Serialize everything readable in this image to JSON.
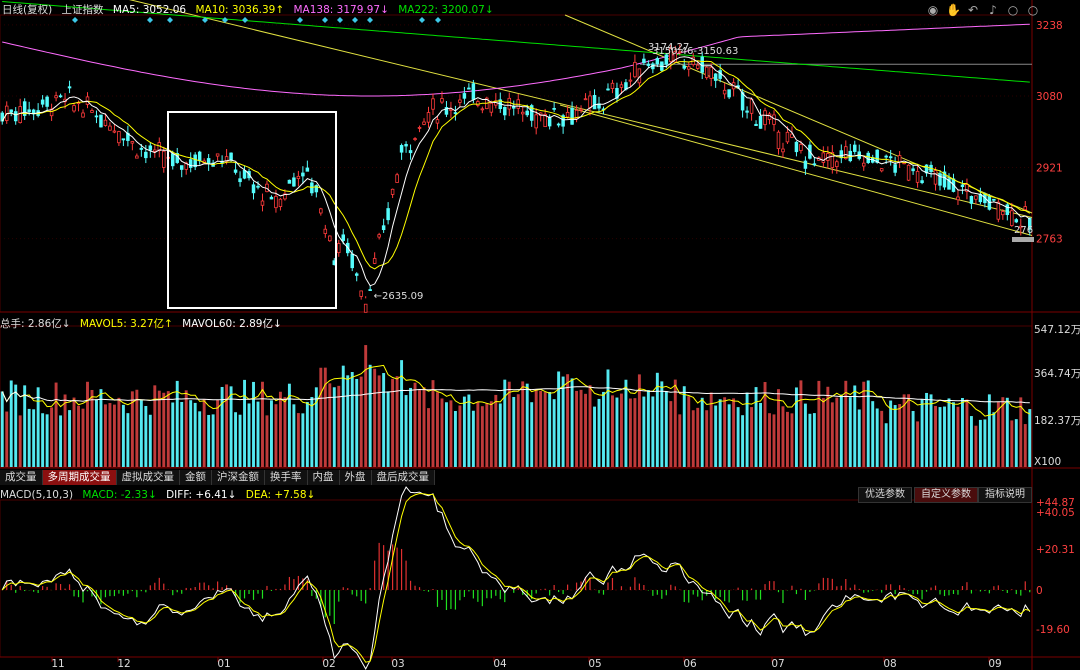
{
  "header": {
    "title": "日线(复权)",
    "symbol": "上证指数",
    "ma5": "MA5: 3052.06",
    "ma10": "MA10: 3036.39↑",
    "ma138": "MA138: 3179.97↓",
    "ma222": "MA222: 3200.07↓"
  },
  "volume_header": {
    "total": "总手: 2.86亿↓",
    "mavol5": "MAVOL5: 3.27亿↑",
    "mavol60": "MAVOL60: 2.89亿↓"
  },
  "macd_header": {
    "name": "MACD(5,10,3)",
    "macd": "MACD: -2.33↓",
    "diff": "DIFF: +6.41↓",
    "dea": "DEA: +7.58↓"
  },
  "tabs": [
    "成交量",
    "多周期成交量",
    "虚拟成交量",
    "金额",
    "沪深金额",
    "换手率",
    "内盘",
    "外盘",
    "盘后成交量"
  ],
  "active_tab": 1,
  "buttons": {
    "preferred": "优选参数",
    "custom": "自定义参数",
    "help": "指标说明"
  },
  "icons": [
    "eye-icon",
    "hand-icon",
    "undo-icon",
    "bell-icon",
    "circle-icon",
    "circle-icon"
  ],
  "price_axis": [
    "3238",
    "3080",
    "2921",
    "2763"
  ],
  "volume_axis": [
    "547.12万",
    "364.74万",
    "182.37万",
    "X100"
  ],
  "macd_axis": [
    "+44.87",
    "+40.05",
    "+20.31",
    "0",
    "-19.60"
  ],
  "month_labels": [
    "11",
    "12",
    "01",
    "02",
    "03",
    "04",
    "05",
    "06",
    "07",
    "08",
    "09"
  ],
  "annotations": {
    "low": "2635.09",
    "high_label": "3174.27",
    "resistance": "3150.63",
    "range_label": "3150.46-3150.63",
    "last": "276"
  },
  "colors": {
    "up": "#ff3b3b",
    "down": "#54fcfc",
    "ma5": "#ffffff",
    "ma10": "#ffff00",
    "ma138": "#ff6cff",
    "ma222": "#00e000",
    "trend": "#e0e040",
    "seq": "#ff44ff",
    "grid": "#4a0000"
  },
  "chart_data": {
    "type": "candlestick",
    "ylim": [
      2600,
      3260
    ],
    "key_prices": {
      "low": 2635.09,
      "high": 3174.27
    },
    "volume_ylim": [
      0,
      547.12
    ],
    "macd_ylim": [
      -30,
      44.87
    ],
    "latest": {
      "ma5": 3052.06,
      "ma10": 3036.39,
      "ma138": 3179.97,
      "ma222": 3200.07,
      "vol": 2.86,
      "mavol5": 3.27,
      "mavol60": 2.89,
      "macd": -2.33,
      "diff": 6.41,
      "dea": 7.58
    }
  }
}
